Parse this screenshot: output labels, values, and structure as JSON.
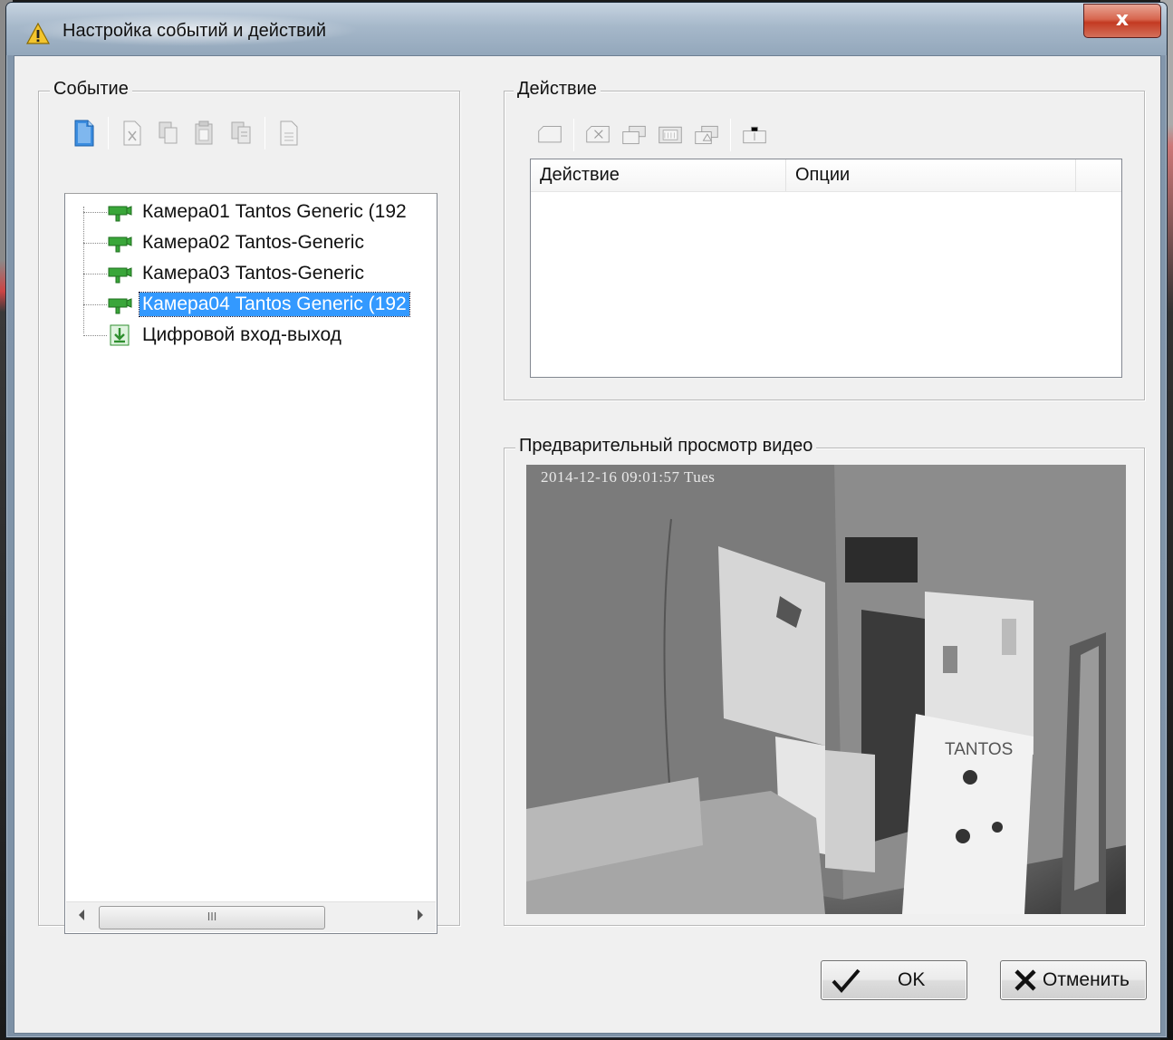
{
  "window": {
    "title": "Настройка событий и действий",
    "close_label": "x"
  },
  "event_group": {
    "label": "Событие",
    "toolbar": [
      "new-doc-icon",
      "delete-doc-icon",
      "copy-doc-icon",
      "paste-doc-icon",
      "duplicate-doc-icon",
      "properties-doc-icon"
    ],
    "tree": [
      {
        "label": "Камера01 Tantos Generic (192",
        "icon": "camera-icon",
        "selected": false
      },
      {
        "label": "Камера02 Tantos-Generic",
        "icon": "camera-icon",
        "selected": false
      },
      {
        "label": "Камера03 Tantos-Generic",
        "icon": "camera-icon",
        "selected": false
      },
      {
        "label": "Камера04 Tantos Generic (192",
        "icon": "camera-icon",
        "selected": true
      },
      {
        "label": "Цифровой вход-выход",
        "icon": "digital-io-icon",
        "selected": false
      }
    ],
    "scroll_thumb_grip": "III"
  },
  "action_group": {
    "label": "Действие",
    "toolbar": [
      "new-action-icon",
      "delete-action-icon",
      "copy-action-icon",
      "paste-action-icon",
      "duplicate-action-icon",
      "properties-action-icon"
    ],
    "columns": [
      "Действие",
      "Опции"
    ],
    "rows": []
  },
  "preview_group": {
    "label": "Предварительный просмотр видео",
    "timestamp": "2014-12-16 09:01:57 Tues",
    "brand_text": "TANTOS"
  },
  "buttons": {
    "ok": "OK",
    "cancel": "Отменить"
  },
  "colors": {
    "selection": "#3399ff",
    "dialog_bg": "#f0f0f0",
    "tree_icon_green": "#3aa63a"
  }
}
